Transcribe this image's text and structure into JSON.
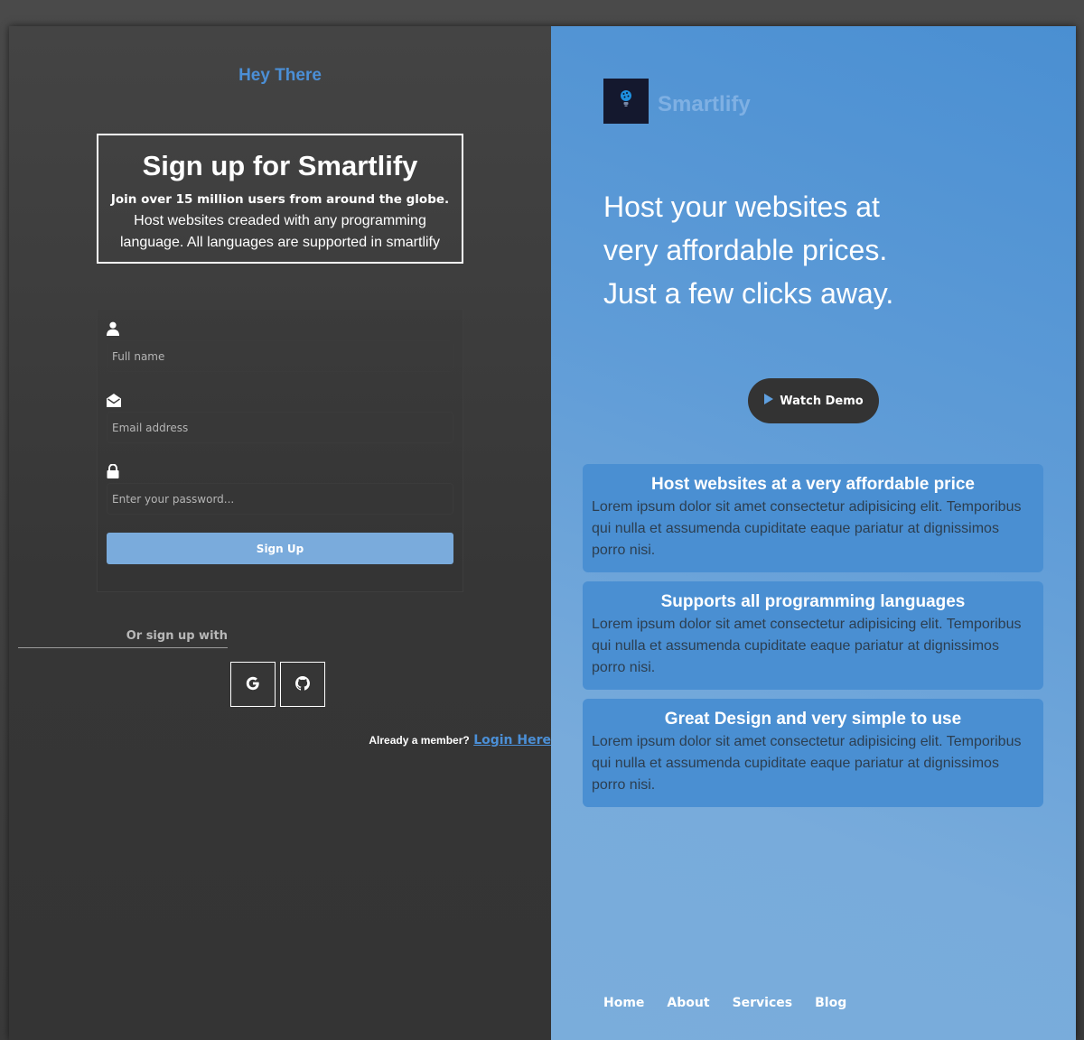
{
  "left": {
    "greeting": "Hey There",
    "intro": {
      "title": "Sign up for Smartlify",
      "tagline": "Join over 15 million users from around the globe.",
      "description": "Host websites creaded with any programming language. All languages are supported in smartlify"
    },
    "form": {
      "fullname": {
        "icon": "user-icon",
        "placeholder": "Full name",
        "value": ""
      },
      "email": {
        "icon": "envelope-open-icon",
        "placeholder": "Email address",
        "value": ""
      },
      "password": {
        "icon": "lock-icon",
        "placeholder": "Enter your password...",
        "value": ""
      },
      "submit_label": "Sign Up"
    },
    "social": {
      "label": "Or sign up with",
      "providers": [
        {
          "name": "google",
          "icon": "google-icon"
        },
        {
          "name": "github",
          "icon": "github-icon"
        }
      ]
    },
    "member": {
      "question": "Already a member?",
      "link_label": "Login Here"
    }
  },
  "right": {
    "brand": "Smartlify",
    "logo_icon": "lightbulb-icon",
    "hero_lines": [
      "Host your websites at",
      "very affordable prices.",
      "Just a few clicks away."
    ],
    "demo_label": "Watch Demo",
    "features": [
      {
        "title": "Host websites at a very affordable price",
        "body": "Lorem ipsum dolor sit amet consectetur adipisicing elit. Temporibus qui nulla et assumenda cupiditate eaque pariatur at dignissimos porro nisi."
      },
      {
        "title": "Supports all programming languages",
        "body": "Lorem ipsum dolor sit amet consectetur adipisicing elit. Temporibus qui nulla et assumenda cupiditate eaque pariatur at dignissimos porro nisi."
      },
      {
        "title": "Great Design and very simple to use",
        "body": "Lorem ipsum dolor sit amet consectetur adipisicing elit. Temporibus qui nulla et assumenda cupiditate eaque pariatur at dignissimos porro nisi."
      }
    ],
    "nav": [
      "Home",
      "About",
      "Services",
      "Blog"
    ]
  },
  "colors": {
    "accent": "#4b8fd6",
    "button": "#7aabdc",
    "card": "#4a8fd2",
    "dark_panel": "#3a3a3a"
  }
}
